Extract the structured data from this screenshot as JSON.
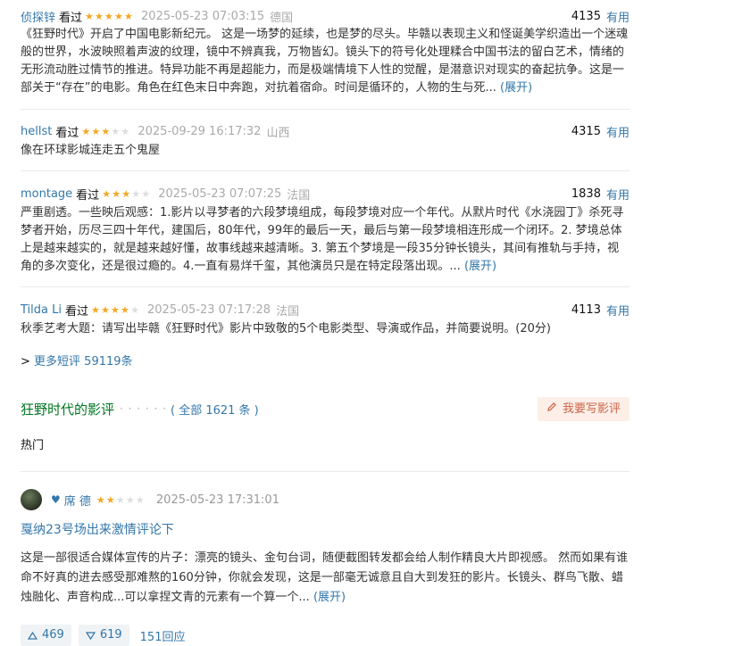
{
  "comments": [
    {
      "user": "侦探锌",
      "status": "看过",
      "stars": 5,
      "time": "2025-05-23 07:03:15",
      "location": "德国",
      "votes": "4135",
      "useful_label": "有用",
      "text": "《狂野时代》开启了中国电影新纪元。 这是一场梦的延续，也是梦的尽头。毕赣以表现主义和怪诞美学织造出一个迷魂般的世界，水波映照着声波的纹理，镜中不辨真我，万物皆幻。镜头下的符号化处理糅合中国书法的留白艺术，情绪的无形流动胜过情节的推进。特异功能不再是超能力，而是极端情境下人性的觉醒，是潜意识对现实的奋起抗争。这是一部关于“存在”的电影。角色在红色末日中奔跑，对抗着宿命。时间是循环的，人物的生与死...",
      "expand_label": "(展开)"
    },
    {
      "user": "hellst",
      "status": "看过",
      "stars": 3,
      "time": "2025-09-29 16:17:32",
      "location": "山西",
      "votes": "4315",
      "useful_label": "有用",
      "text": "像在环球影城连走五个鬼屋",
      "expand_label": ""
    },
    {
      "user": "montage",
      "status": "看过",
      "stars": 3,
      "time": "2025-05-23 07:07:25",
      "location": "法国",
      "votes": "1838",
      "useful_label": "有用",
      "text": "严重剧透。一些映后观感：1.影片以寻梦者的六段梦境组成，每段梦境对应一个年代。从默片时代《水浇园丁》杀死寻梦者开始，历尽三四十年代，建国后，80年代，99年的最后一天，最后与第一段梦境相连形成一个闭环。2. 梦境总体上是越来越实的，就是越来越好懂，故事线越来越清晰。3. 第五个梦境是一段35分钟长镜头，其间有推轨与手持，视角的多次变化，还是很过瘾的。4.一直有易烊千玺，其他演员只是在特定段落出现。...",
      "expand_label": "(展开)"
    },
    {
      "user": "Tilda Li",
      "status": "看过",
      "stars": 4,
      "time": "2025-05-23 07:17:28",
      "location": "法国",
      "votes": "4113",
      "useful_label": "有用",
      "text": "秋季艺考大题：请写出毕赣《狂野时代》影片中致敬的5个电影类型、导演或作品，并简要说明。(20分)",
      "expand_label": ""
    }
  ],
  "more_comments": {
    "prefix": ">",
    "label": "更多短评 59119条"
  },
  "reviews_section": {
    "title": "狂野时代的影评",
    "dots": "· · · · · ·",
    "count": "( 全部 1621 条 )",
    "write_label": "我要写影评",
    "filter": "热门"
  },
  "review": {
    "author": "席 德",
    "stars": 2,
    "time": "2025-05-23 17:31:01",
    "title": "戛纳23号场出来激情评论下",
    "text": "这是一部很适合媒体宣传的片子：漂亮的镜头、金句台词，随便截图转发都会给人制作精良大片即视感。 然而如果有谁命不好真的进去感受那难熬的160分钟，你就会发现，这是一部毫无诚意且自大到发狂的影片。长镜头、群鸟飞散、蜡烛融化、声音构成...可以拿捏文青的元素有一个算一个...",
    "expand_label": "(展开)",
    "up": "469",
    "down": "619",
    "replies": "151回应"
  },
  "icons": {
    "star": "star-icon",
    "pencil": "pencil-icon",
    "heart": "heart-icon",
    "thumb_up": "thumb-up-icon",
    "thumb_down": "thumb-down-icon"
  }
}
